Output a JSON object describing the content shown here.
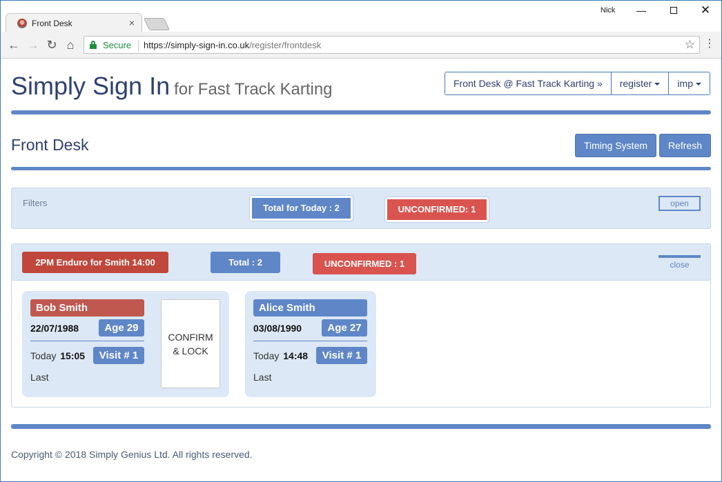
{
  "browser": {
    "tab_title": "Front Desk",
    "tab_close": "×",
    "profile_name": "Nick",
    "window": {
      "minimize": "—",
      "close": "✕"
    },
    "nav": {
      "back": "←",
      "forward": "→",
      "reload": "↻",
      "home": "⌂"
    },
    "secure_label": "Secure",
    "url_host": "https://simply-sign-in.co.uk",
    "url_path": "/register/frontdesk",
    "star": "☆",
    "menu": "⋮"
  },
  "header": {
    "brand": "Simply Sign In",
    "brand_sub": "for Fast Track Karting",
    "location_button": "Front Desk @ Fast Track Karting »",
    "register_button": "register",
    "user_button": "imp"
  },
  "page": {
    "title": "Front Desk",
    "timing_button": "Timing System",
    "refresh_button": "Refresh"
  },
  "filters": {
    "label": "Filters",
    "total_badge": "Total for Today : 2",
    "unconfirmed_badge": "UNCONFIRMED: 1",
    "toggle": "open"
  },
  "session": {
    "name": "2PM Enduro for Smith 14:00",
    "total_badge": "Total : 2",
    "unconfirmed_badge": "UNCONFIRMED : 1",
    "toggle": "close",
    "cards": [
      {
        "name": "Bob Smith",
        "dob": "22/07/1988",
        "age": "Age 29",
        "today_label": "Today",
        "today_time": "15:05",
        "visit": "Visit # 1",
        "last_label": "Last",
        "confirm_label": "CONFIRM & LOCK",
        "status_color": "#c0584f"
      },
      {
        "name": "Alice Smith",
        "dob": "03/08/1990",
        "age": "Age 27",
        "today_label": "Today",
        "today_time": "14:48",
        "visit": "Visit # 1",
        "last_label": "Last",
        "status_color": "#5f87c7"
      }
    ]
  },
  "footer": {
    "copyright": "Copyright © 2018 Simply Genius Ltd. All rights reserved."
  },
  "colors": {
    "accent": "#5f87c7",
    "danger": "#d9534f",
    "session": "#c0473b",
    "panel": "#dce8f5",
    "brand_text": "#2f3f6e"
  }
}
